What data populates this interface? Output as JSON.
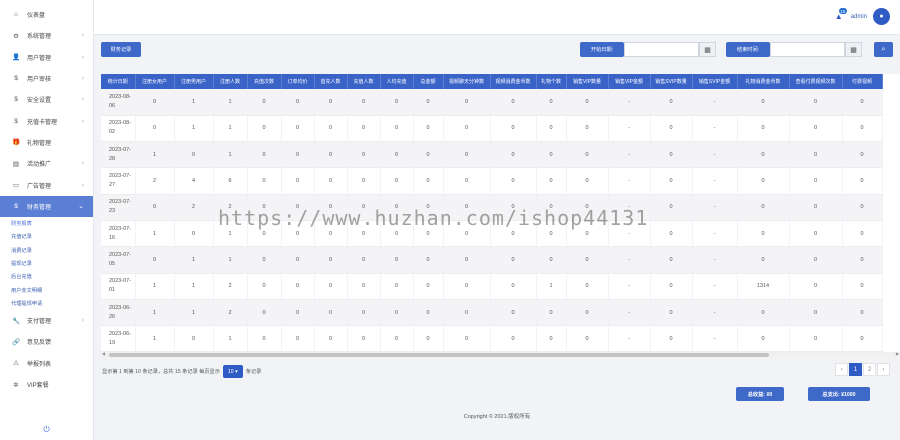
{
  "sidebar": {
    "items": [
      {
        "label": "仪表盘",
        "icon": "home-icon",
        "glyph": "⌂",
        "chevron": false
      },
      {
        "label": "系统管理",
        "icon": "settings-icon",
        "glyph": "⚙",
        "chevron": true
      },
      {
        "label": "用户管理",
        "icon": "user-icon",
        "glyph": "👤",
        "chevron": true
      },
      {
        "label": "用户审核",
        "icon": "dollar-icon",
        "glyph": "$",
        "chevron": true
      },
      {
        "label": "安全设置",
        "icon": "dollar-icon",
        "glyph": "$",
        "chevron": true
      },
      {
        "label": "充值卡管理",
        "icon": "dollar-icon",
        "glyph": "$",
        "chevron": true
      },
      {
        "label": "礼物管理",
        "icon": "gift-icon",
        "glyph": "🎁",
        "chevron": false
      },
      {
        "label": "活动推广",
        "icon": "chart-icon",
        "glyph": "▤",
        "chevron": true
      },
      {
        "label": "广告管理",
        "icon": "monitor-icon",
        "glyph": "▭",
        "chevron": true
      },
      {
        "label": "财务管理",
        "icon": "dollar-icon",
        "glyph": "$",
        "chevron": true,
        "open": true
      }
    ],
    "sub_items": [
      "财务报表",
      "充值记录",
      "消费记录",
      "提现记录",
      "后台充值",
      "用户赤文明细",
      "代理提现申请"
    ],
    "items_after": [
      {
        "label": "支付管理",
        "icon": "wrench-icon",
        "glyph": "🔧",
        "chevron": true
      },
      {
        "label": "意见反馈",
        "icon": "link-icon",
        "glyph": "🔗",
        "chevron": false
      },
      {
        "label": "举报列表",
        "icon": "warning-icon",
        "glyph": "⚠",
        "chevron": false
      },
      {
        "label": "VIP套餐",
        "icon": "gear-icon",
        "glyph": "✲",
        "chevron": false
      }
    ]
  },
  "header": {
    "badge_count": "15",
    "username": "admin"
  },
  "toolbar": {
    "report_button": "财务记录",
    "start_date_label": "开始日期:",
    "end_date_label": "结束时间:",
    "start_date_value": "",
    "end_date_value": ""
  },
  "table": {
    "headers": [
      "统计日期",
      "注册女用户",
      "注册男用户",
      "注册人数",
      "充值次数",
      "订单均价",
      "首充人数",
      "充值人数",
      "人均充值",
      "总金额",
      "视频聊天分钟数",
      "视频消费金币数",
      "礼物个数",
      "销售VIP数量",
      "销售VIP金额",
      "销售SVIP数量",
      "销售SVIP金额",
      "礼物消费金币数",
      "查看付费视频次数",
      "付费视频"
    ],
    "rows": [
      [
        "2023-08-06",
        "0",
        "1",
        "1",
        "0",
        "0",
        "0",
        "0",
        "0",
        "0",
        "0",
        "0",
        "0",
        "0",
        "-",
        "0",
        "-",
        "0",
        "0",
        "0"
      ],
      [
        "2023-08-02",
        "0",
        "1",
        "1",
        "0",
        "0",
        "0",
        "0",
        "0",
        "0",
        "0",
        "0",
        "0",
        "0",
        "-",
        "0",
        "-",
        "0",
        "0",
        "0"
      ],
      [
        "2023-07-28",
        "1",
        "0",
        "1",
        "0",
        "0",
        "0",
        "0",
        "0",
        "0",
        "0",
        "0",
        "0",
        "0",
        "-",
        "0",
        "-",
        "0",
        "0",
        "0"
      ],
      [
        "2023-07-27",
        "2",
        "4",
        "6",
        "0",
        "0",
        "0",
        "0",
        "0",
        "0",
        "0",
        "0",
        "0",
        "0",
        "-",
        "0",
        "-",
        "0",
        "0",
        "0"
      ],
      [
        "2023-07-23",
        "0",
        "2",
        "2",
        "0",
        "0",
        "0",
        "0",
        "0",
        "0",
        "0",
        "0",
        "0",
        "0",
        "-",
        "0",
        "-",
        "0",
        "0",
        "0"
      ],
      [
        "2023-07-16",
        "1",
        "0",
        "1",
        "0",
        "0",
        "0",
        "0",
        "0",
        "0",
        "0",
        "0",
        "0",
        "0",
        "-",
        "0",
        "-",
        "0",
        "0",
        "0"
      ],
      [
        "2023-07-05",
        "0",
        "1",
        "1",
        "0",
        "0",
        "0",
        "0",
        "0",
        "0",
        "0",
        "0",
        "0",
        "0",
        "-",
        "0",
        "-",
        "0",
        "0",
        "0"
      ],
      [
        "2023-07-01",
        "1",
        "1",
        "2",
        "0",
        "0",
        "0",
        "0",
        "0",
        "0",
        "0",
        "0",
        "1",
        "0",
        "-",
        "0",
        "-",
        "1314",
        "0",
        "0"
      ],
      [
        "2023-06-26",
        "1",
        "1",
        "2",
        "0",
        "0",
        "0",
        "0",
        "0",
        "0",
        "0",
        "0",
        "0",
        "0",
        "-",
        "0",
        "-",
        "0",
        "0",
        "0"
      ],
      [
        "2023-06-19",
        "1",
        "0",
        "1",
        "0",
        "0",
        "0",
        "0",
        "0",
        "0",
        "0",
        "0",
        "0",
        "0",
        "-",
        "0",
        "-",
        "0",
        "0",
        "0"
      ]
    ]
  },
  "pagination": {
    "info_prefix": "显示第 1 到第 10 条记录，总共 15 条记录 每页显示",
    "per_page": "10",
    "info_suffix": "条记录",
    "prev": "‹",
    "pages": [
      "1",
      "2"
    ],
    "next": "›",
    "current": "1"
  },
  "totals": {
    "income": "总收益: ¥0",
    "expense": "总支出: ¥1000"
  },
  "footer": "Copyright © 2021.版权所有",
  "watermark": "https://www.huzhan.com/ishop44131",
  "colors": {
    "primary": "#3a63c8",
    "sidebar_active": "#4a6cc0"
  }
}
